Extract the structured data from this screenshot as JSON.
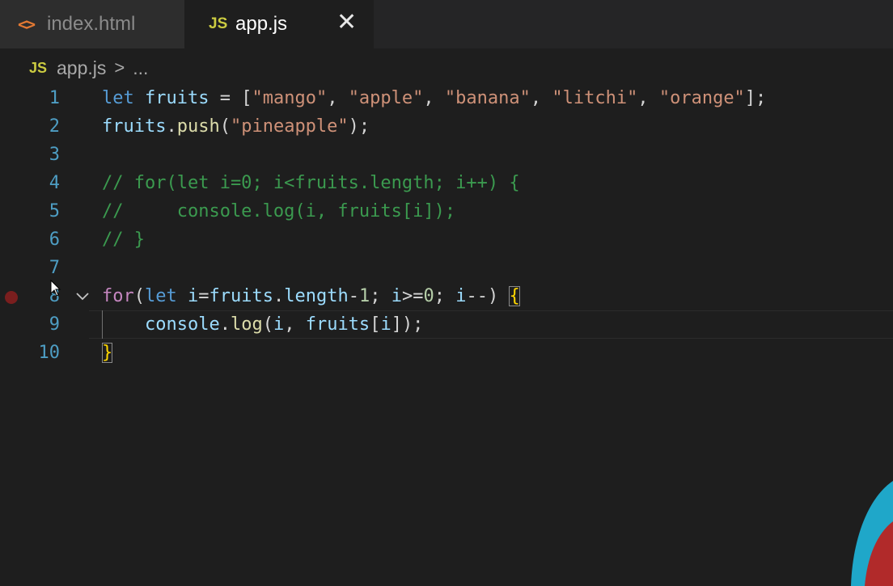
{
  "tabs": [
    {
      "icon": "<>",
      "label": "index.html"
    },
    {
      "icon": "JS",
      "label": "app.js"
    }
  ],
  "tab_close": "✕",
  "breadcrumb": {
    "icon": "JS",
    "file": "app.js",
    "separator": ">",
    "more": "..."
  },
  "line_numbers": [
    "1",
    "2",
    "3",
    "4",
    "5",
    "6",
    "7",
    "8",
    "9",
    "10"
  ],
  "code": {
    "l1": {
      "let": "let",
      "fruits": "fruits",
      "eq": " = [",
      "s1": "\"mango\"",
      "c1": ", ",
      "s2": "\"apple\"",
      "c2": ", ",
      "s3": "\"banana\"",
      "c3": ", ",
      "s4": "\"litchi\"",
      "c4": ", ",
      "s5": "\"orange\"",
      "end": "];"
    },
    "l2": {
      "fruits": "fruits",
      "dot": ".",
      "push": "push",
      "open": "(",
      "s": "\"pineapple\"",
      "close": ");"
    },
    "l4": "// for(let i=0; i<fruits.length; i++) {",
    "l5": "//     console.log(i, fruits[i]);",
    "l6": "// }",
    "l8": {
      "for": "for",
      "open": "(",
      "let": "let",
      "sp": " ",
      "i": "i",
      "eq": "=",
      "fruits": "fruits",
      "dot": ".",
      "length": "length",
      "minus": "-",
      "one": "1",
      "semi1": "; ",
      "i2": "i",
      "gte": ">=",
      "zero": "0",
      "semi2": "; ",
      "i3": "i",
      "dec": "--",
      "close": ") ",
      "brace": "{"
    },
    "l9": {
      "indent": "    ",
      "console": "console",
      "dot": ".",
      "log": "log",
      "open": "(",
      "i": "i",
      "comma": ", ",
      "fruits": "fruits",
      "lb": "[",
      "i2": "i",
      "rb": "]",
      "close": ");"
    },
    "l10": "}"
  },
  "colors": {
    "keyword": "#569cd6",
    "control": "#c586c0",
    "variable": "#9cdcfe",
    "function": "#dcdcaa",
    "string": "#ce9178",
    "number": "#b5cea8",
    "comment": "#3b9a4f",
    "line_number": "#4e9ec4",
    "breakpoint": "#7a1e1e"
  }
}
